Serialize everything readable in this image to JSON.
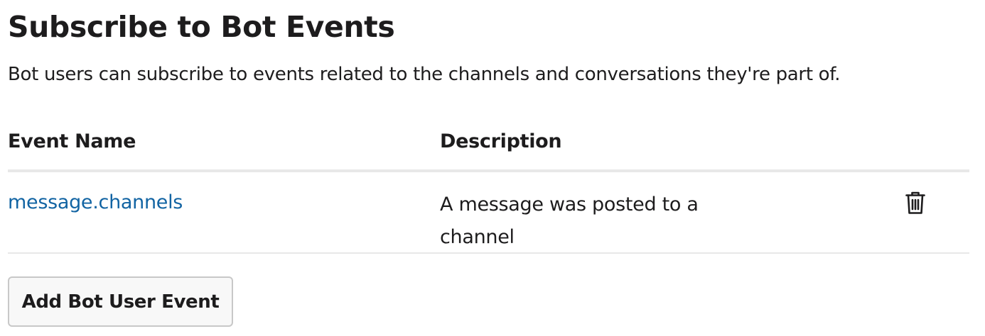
{
  "section": {
    "title": "Subscribe to Bot Events",
    "description": "Bot users can subscribe to events related to the channels and conversations they're part of."
  },
  "table": {
    "headers": {
      "event_name": "Event Name",
      "description": "Description"
    },
    "rows": [
      {
        "event_name": "message.channels",
        "description": "A message was posted to a channel",
        "action_icon": "trash-icon"
      }
    ]
  },
  "add_button_label": "Add Bot User Event",
  "colors": {
    "link": "#1264a3",
    "text": "#1d1c1d",
    "divider": "#e8e8e8",
    "button_border": "#c8c8c8",
    "button_bg": "#f8f8f8"
  }
}
